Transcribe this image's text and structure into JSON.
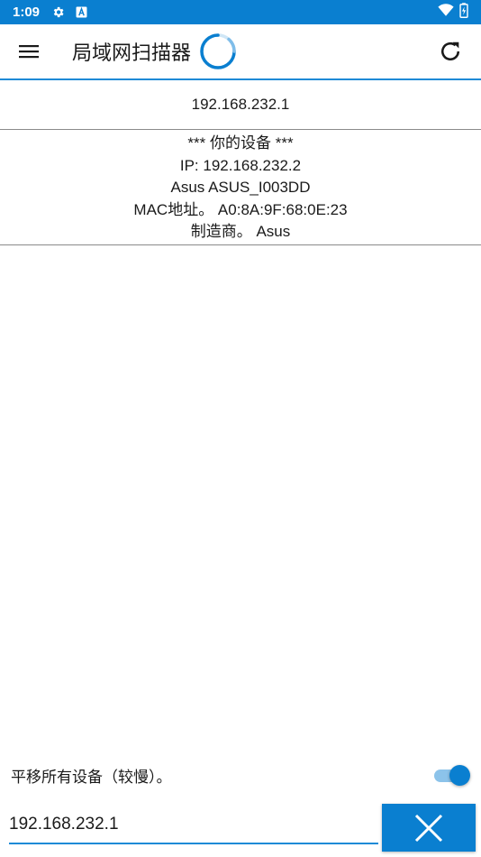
{
  "status_bar": {
    "time": "1:09",
    "icons": [
      "gear-icon",
      "a-badge-icon",
      "wifi-icon",
      "battery-charging-icon"
    ]
  },
  "app_bar": {
    "title": "局域网扫描器",
    "menu_icon": "hamburger-menu-icon",
    "refresh_icon": "refresh-icon",
    "loading": true
  },
  "devices": [
    {
      "lines": [
        "192.168.232.1"
      ]
    },
    {
      "lines": [
        "*** 你的设备 ***",
        "IP: 192.168.232.2",
        "Asus ASUS_I003DD",
        "MAC地址。 A0:8A:9F:68:0E:23",
        "制造商。 Asus"
      ]
    }
  ],
  "controls": {
    "toggle_label": "平移所有设备（较慢）。",
    "toggle_on": true,
    "ip_value": "192.168.232.1",
    "cancel_icon": "close-icon"
  },
  "colors": {
    "accent": "#0a7fd0",
    "accent_light": "#8cc3ea",
    "divider": "#8a8a8a"
  }
}
